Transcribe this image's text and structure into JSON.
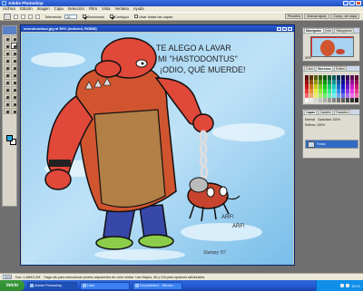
{
  "window": {
    "title": "Adobe Photoshop"
  },
  "menubar": [
    "Archivo",
    "Edición",
    "Imagen",
    "Capa",
    "Selección",
    "Filtro",
    "Vista",
    "Ventana",
    "Ayuda"
  ],
  "options": {
    "tolerance_label": "Tolerancia:",
    "tolerance_value": "32",
    "antialias_label": "Suavizado",
    "contiguous_label": "Contiguo",
    "all_layers_label": "Usar todas las capas"
  },
  "palette_well": [
    "Pinceles",
    "Marcar ajust.",
    "Comp. de capa"
  ],
  "document": {
    "title": "monstrumbus.jpg al 50% (Indexed, RGB/8)",
    "speech_line1": "TE ALEGO A LAVAR",
    "speech_line2": "A MI \"HASTODONTUS\"",
    "speech_line3": "¡ODIO, QUÉ MUERDE!",
    "dog_sound1": "ARF!",
    "dog_sound2": "ARF!",
    "signature": "Stampy '07"
  },
  "navigator": {
    "tabs": [
      "Navegador",
      "Info",
      "Histograma"
    ],
    "zoom": "50%"
  },
  "color_panel": {
    "tabs": [
      "Color",
      "Muestras",
      "Estilos"
    ]
  },
  "layers_panel": {
    "tabs": [
      "Capas",
      "Canales",
      "Trazados"
    ],
    "blend_mode": "Normal",
    "opacity_label": "Opacidad: 100%",
    "fill_label": "Relleno: 100%",
    "layer_name": "Fondo"
  },
  "statusbar": {
    "zoom": "50%",
    "doc_info": "Doc: 1,46M/1,0M",
    "hint": "Haga clic para seleccionar píxeles adyacentes de color similar. Use Mayús, Alt y Ctrl para opciones adicionales."
  },
  "taskbar": {
    "start": "Inicio",
    "tasks": [
      "Adobe Photoshop",
      "Listo",
      "Documento1 - Micros..."
    ],
    "clock": "10:21"
  },
  "colors": {
    "title_bar": "#1f4fc7",
    "foreground_swatch": "#29a8df",
    "background_swatch": "#ffffff"
  }
}
